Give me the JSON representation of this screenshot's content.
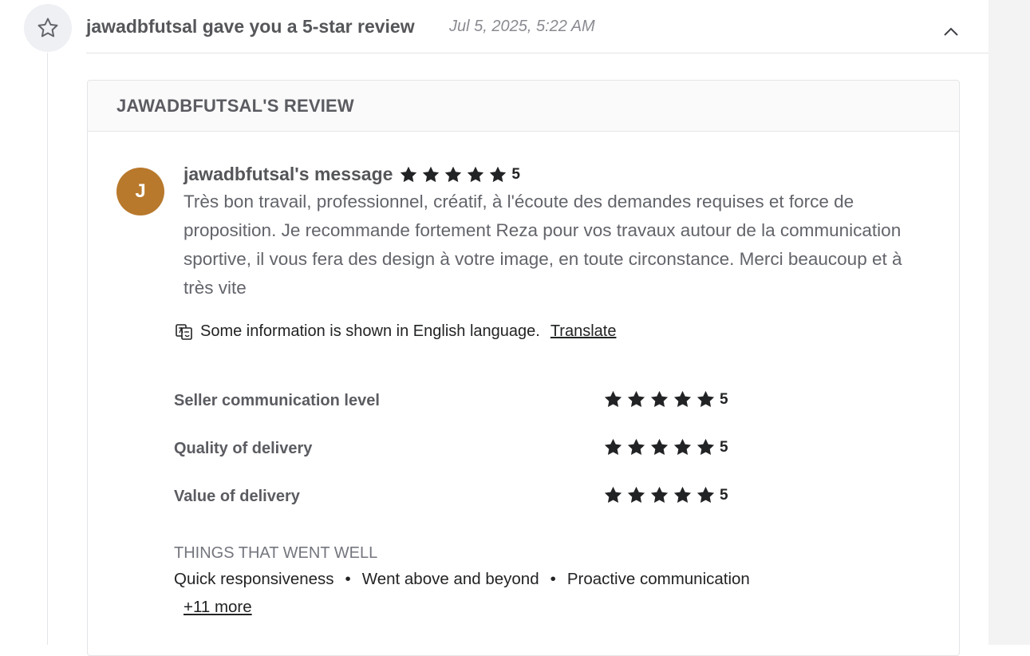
{
  "event": {
    "icon": "star-outline-icon",
    "title": "jawadbfutsal gave you a 5-star review",
    "date": "Jul 5, 2025, 5:22 AM",
    "collapse_icon": "chevron-up-icon"
  },
  "review": {
    "header": "JAWADBFUTSAL'S REVIEW",
    "avatar_initial": "J",
    "avatar_color": "#b8792c",
    "author_label": "jawadbfutsal's message",
    "overall_rating": 5,
    "overall_rating_text": "5",
    "message": "Très bon travail, professionnel, créatif, à l'écoute des demandes requises et force de proposition. Je recommande fortement Reza pour vos travaux autour de la communication sportive, il vous fera des design à votre image, en toute circonstance. Merci beaucoup et à très vite",
    "translate_notice": "Some information is shown in English language.",
    "translate_link": "Translate",
    "ratings": [
      {
        "label": "Seller communication level",
        "value": 5,
        "value_text": "5"
      },
      {
        "label": "Quality of delivery",
        "value": 5,
        "value_text": "5"
      },
      {
        "label": "Value of delivery",
        "value": 5,
        "value_text": "5"
      }
    ],
    "went_well": {
      "title": "THINGS THAT WENT WELL",
      "items": [
        "Quick responsiveness",
        "Went above and beyond",
        "Proactive communication"
      ],
      "more_link": "+11 more"
    }
  },
  "colors": {
    "star_fill": "#222325",
    "icon_bg": "#eef0f4"
  }
}
